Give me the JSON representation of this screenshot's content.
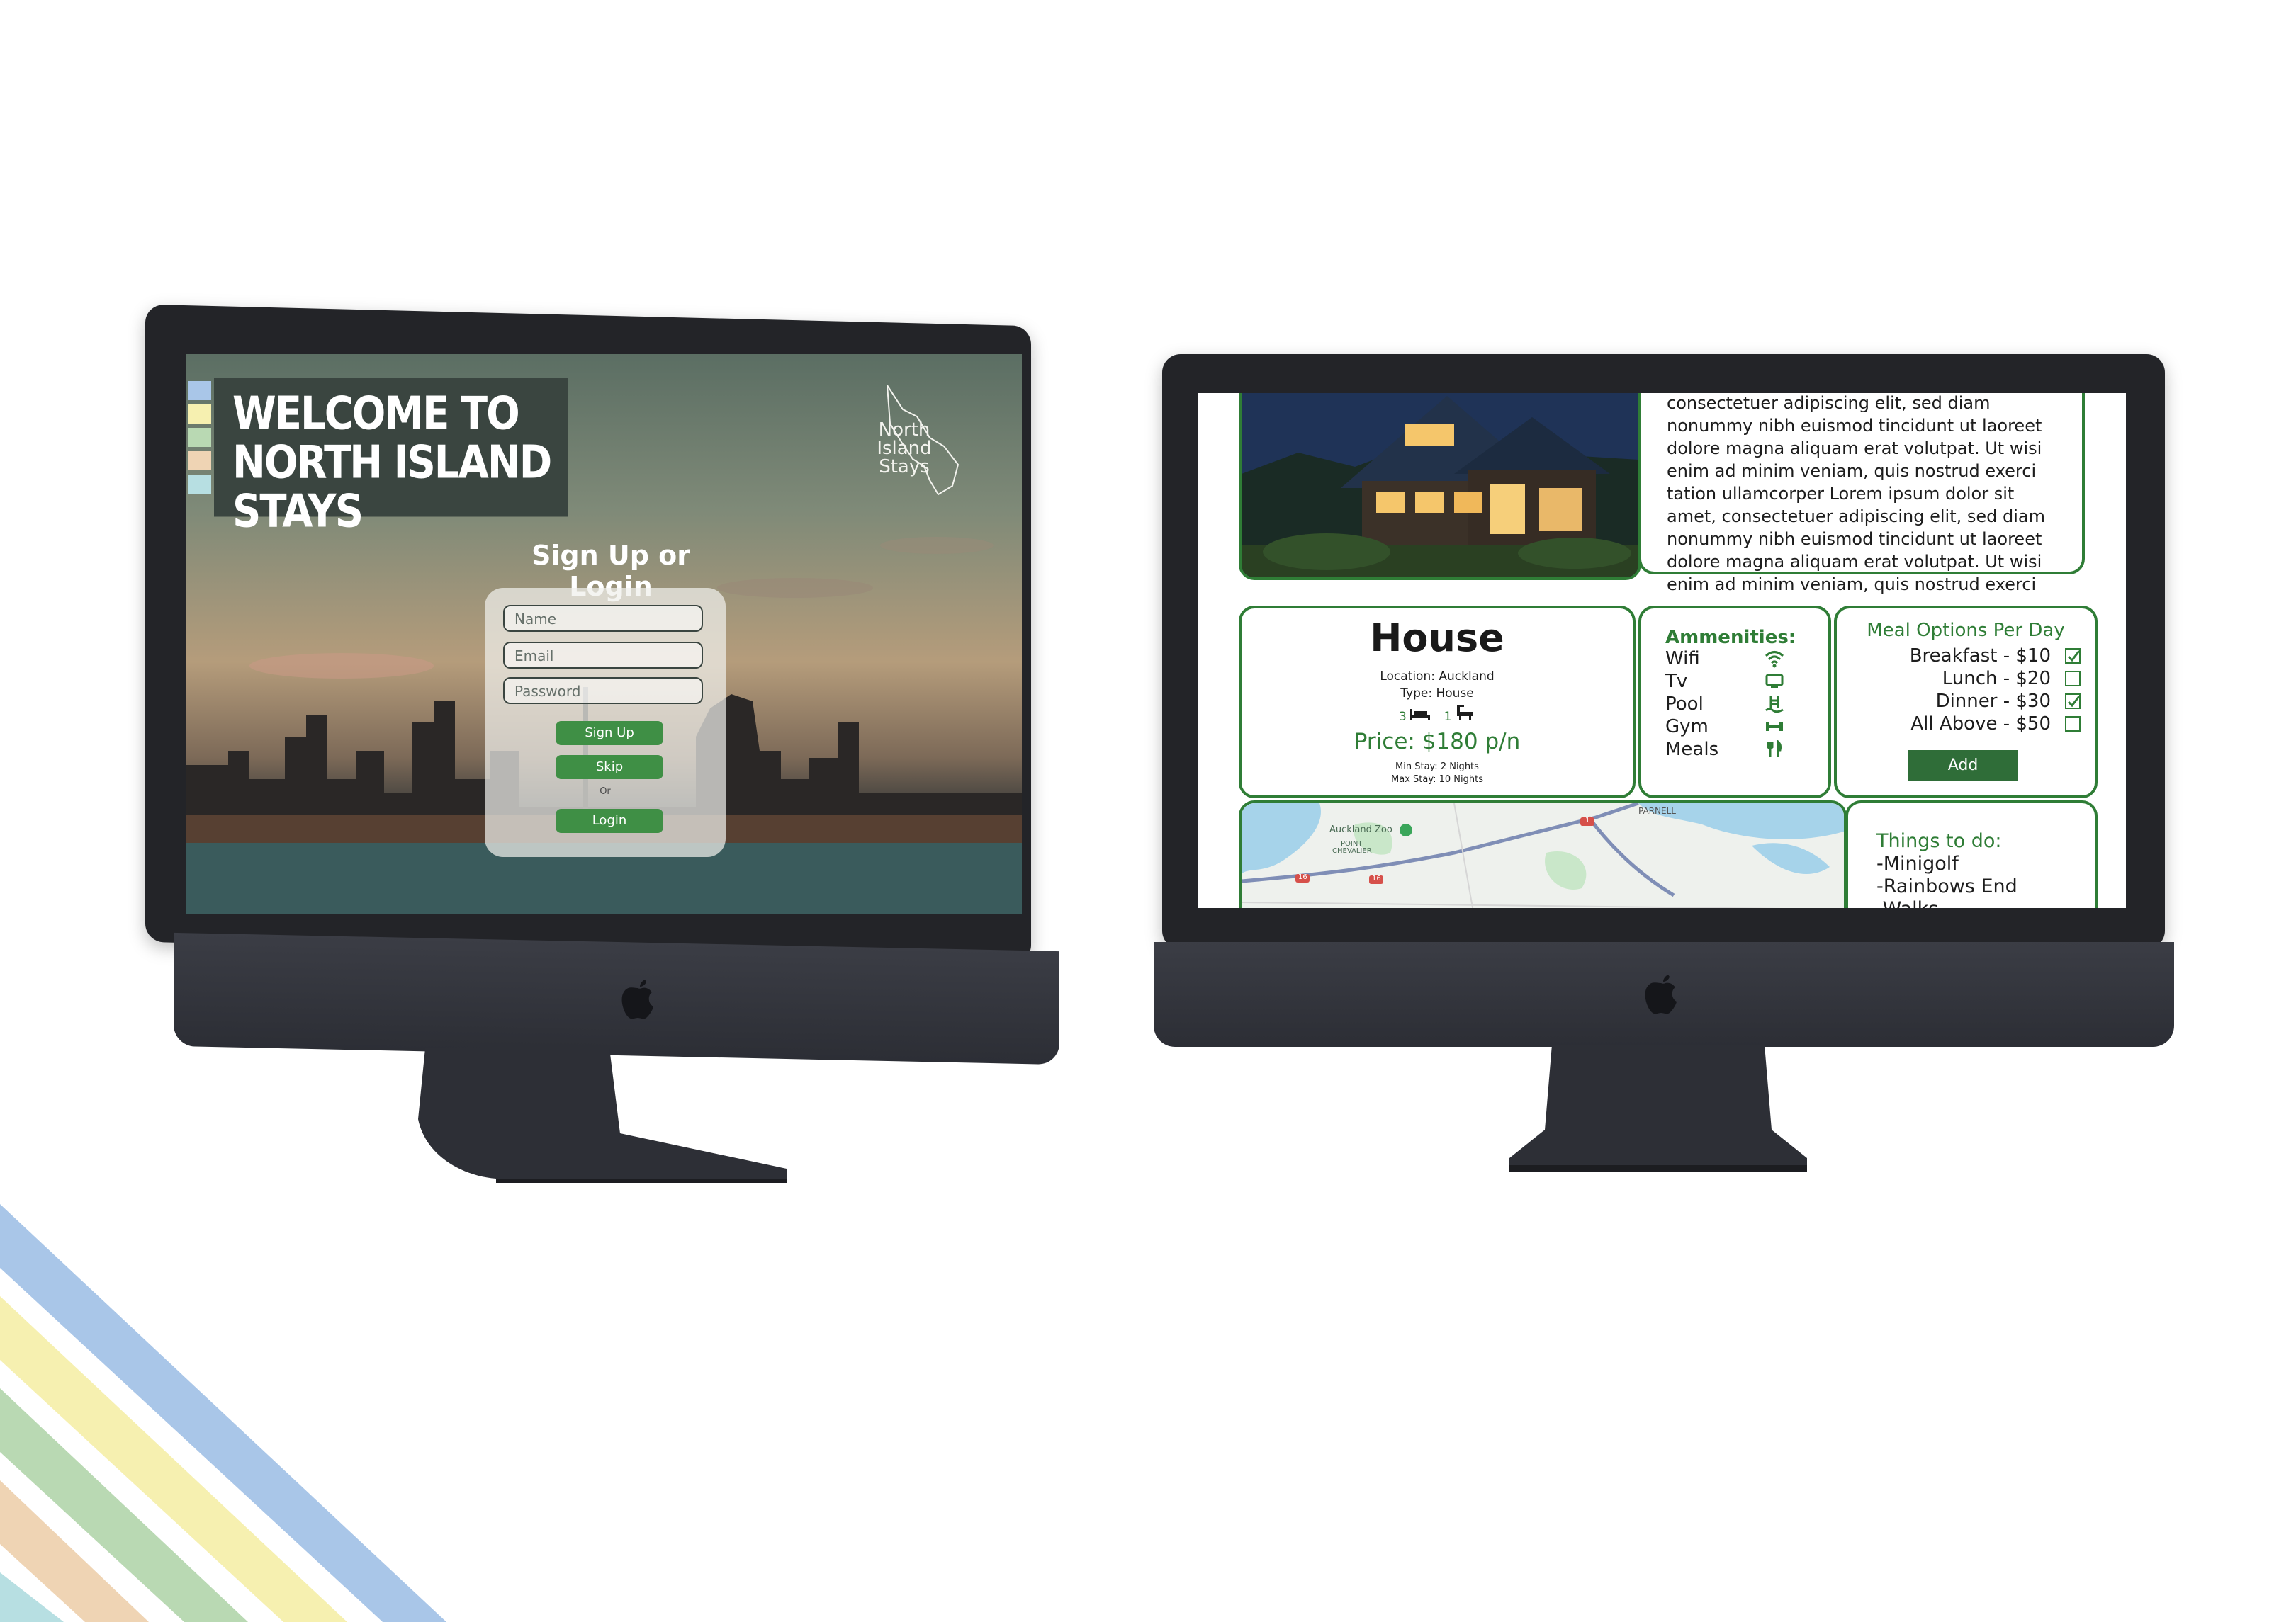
{
  "colors": {
    "green": "#2f7d36",
    "button_green": "#3f8f45",
    "banner_bg": "#3a4540",
    "tab_colors": [
      "#a9c6e8",
      "#f6f0b0",
      "#b9d9b3",
      "#efd4b4",
      "#b7dfe2"
    ],
    "stripe_colors": [
      "#a9c6e8",
      "#f6f0b0",
      "#b9d9b3",
      "#efd4b4",
      "#b7dfe2"
    ]
  },
  "left_screen": {
    "welcome_line1": "WELCOME TO",
    "welcome_line2": "NORTH ISLAND STAYS",
    "logo_line1": "North",
    "logo_line2": "Island",
    "logo_line3": "Stays",
    "form_title": "Sign Up or Login",
    "name_placeholder": "Name",
    "email_placeholder": "Email",
    "password_placeholder": "Password",
    "signup_label": "Sign Up",
    "skip_label": "Skip",
    "or_label": "Or",
    "login_label": "Login"
  },
  "right_screen": {
    "lorem_lines": [
      "consectetuer adipiscing elit, sed diam",
      "nonummy nibh euismod tincidunt ut laoreet",
      "dolore magna aliquam erat volutpat. Ut wisi",
      "enim ad minim veniam, quis nostrud exerci",
      "tation ullamcorper Lorem ipsum dolor sit",
      "amet, consectetuer adipiscing elit, sed diam",
      "nonummy nibh euismod tincidunt ut laoreet",
      "dolore magna aliquam erat volutpat. Ut wisi",
      "enim ad minim veniam, quis nostrud exerci"
    ],
    "listing": {
      "title": "House",
      "location": "Location: Auckland",
      "type": "Type: House",
      "beds": "3",
      "baths": "1",
      "price": "Price: $180 p/n",
      "min_stay": "Min Stay: 2 Nights",
      "max_stay": "Max Stay: 10 Nights"
    },
    "amenities": {
      "title": "Ammenities:",
      "items": [
        {
          "label": "Wifi",
          "icon": "wifi-icon"
        },
        {
          "label": "Tv",
          "icon": "tv-icon"
        },
        {
          "label": "Pool",
          "icon": "pool-icon"
        },
        {
          "label": "Gym",
          "icon": "dumbbell-icon"
        },
        {
          "label": "Meals",
          "icon": "cutlery-icon"
        }
      ]
    },
    "meals": {
      "title": "Meal Options Per Day",
      "options": [
        {
          "label": "Breakfast - $10",
          "checked": true
        },
        {
          "label": "Lunch - $20",
          "checked": false
        },
        {
          "label": "Dinner - $30",
          "checked": true
        },
        {
          "label": "All Above - $50",
          "checked": false
        }
      ],
      "add_label": "Add"
    },
    "map": {
      "label_zoo": "Auckland Zoo",
      "label_point": "POINT",
      "label_chevalier": "CHEVALIER",
      "label_parnell": "PARNELL",
      "label_16a": "16",
      "label_16b": "16",
      "label_1": "1"
    },
    "todo": {
      "title": "Things to do:",
      "items": [
        "-Minigolf",
        "-Rainbows End",
        "-Walks"
      ]
    }
  }
}
